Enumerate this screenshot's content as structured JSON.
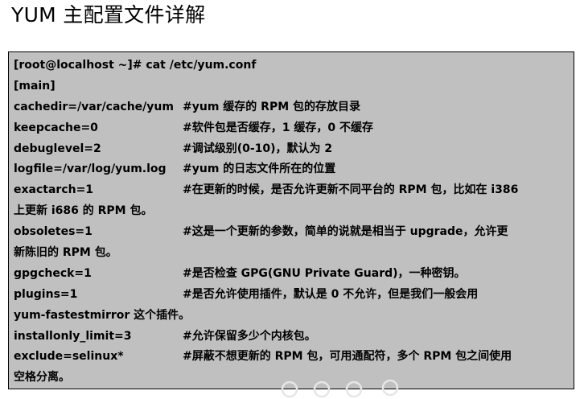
{
  "title": "YUM 主配置文件详解",
  "config": {
    "prompt": "[root@localhost ~]#  cat /etc/yum.conf",
    "section": "[main]",
    "lines": [
      {
        "key": "cachedir=/var/cache/yum",
        "comment": "#yum 缓存的 RPM 包的存放目录"
      },
      {
        "key": "keepcache=0",
        "comment": "#软件包是否缓存，1 缓存，0 不缓存"
      },
      {
        "key": "debuglevel=2",
        "comment": "#调试级别(0-10)，默认为 2"
      },
      {
        "key": "logfile=/var/log/yum.log",
        "comment": "#yum 的日志文件所在的位置"
      },
      {
        "key": "exactarch=1",
        "comment": "#在更新的时候，是否允许更新不同平台的 RPM 包，比如在 i386",
        "cont": "上更新 i686 的 RPM 包。"
      },
      {
        "key": "obsoletes=1",
        "comment": "#这是一个更新的参数，简单的说就是相当于 upgrade，允许更",
        "cont": "新陈旧的 RPM 包。"
      },
      {
        "key": "gpgcheck=1",
        "comment": "#是否检查 GPG(GNU Private Guard)，一种密钥。"
      },
      {
        "key": "plugins=1",
        "comment": "#是否允许使用插件，默认是 0 不允许，但是我们一般会用",
        "cont": "yum-fastestmirror 这个插件。"
      },
      {
        "key": "installonly_limit=3",
        "comment": "#允许保留多少个内核包。"
      },
      {
        "key": "exclude=selinux*",
        "comment": "#屏蔽不想更新的 RPM 包，可用通配符，多个 RPM 包之间使用",
        "cont": "空格分离。"
      }
    ]
  },
  "colors": {
    "box_background": "#c0c0c0",
    "box_border": "#000000",
    "text": "#000000",
    "watermark": "#e6e6e6"
  }
}
